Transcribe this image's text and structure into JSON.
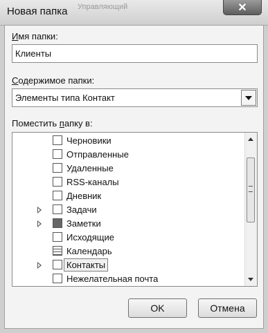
{
  "window": {
    "title": "Новая папка",
    "background_text": "Управляющий"
  },
  "form": {
    "name_label_accel": "И",
    "name_label_rest": "мя папки:",
    "name_value": "Клиенты",
    "content_label_accel": "С",
    "content_label_rest": "одержимое папки:",
    "content_value": "Элементы типа Контакт",
    "place_label_pre": "Поместить ",
    "place_label_accel": "п",
    "place_label_post": "апку в:"
  },
  "tree": {
    "items": [
      {
        "label": "Черновики",
        "icon": "drafts-icon",
        "expandable": false
      },
      {
        "label": "Отправленные",
        "icon": "sent-icon",
        "expandable": false
      },
      {
        "label": "Удаленные",
        "icon": "trash-icon",
        "expandable": false
      },
      {
        "label": "RSS-каналы",
        "icon": "rss-icon",
        "expandable": false
      },
      {
        "label": "Дневник",
        "icon": "journal-icon",
        "expandable": false
      },
      {
        "label": "Задачи",
        "icon": "tasks-icon",
        "expandable": true
      },
      {
        "label": "Заметки",
        "icon": "notes-icon",
        "expandable": true
      },
      {
        "label": "Исходящие",
        "icon": "outbox-icon",
        "expandable": false
      },
      {
        "label": "Календарь",
        "icon": "calendar-icon",
        "expandable": false
      },
      {
        "label": "Контакты",
        "icon": "contacts-icon",
        "expandable": true,
        "selected": true
      },
      {
        "label": "Нежелательная почта",
        "icon": "junk-icon",
        "expandable": false
      }
    ]
  },
  "buttons": {
    "ok": "OK",
    "cancel": "Отмена"
  }
}
